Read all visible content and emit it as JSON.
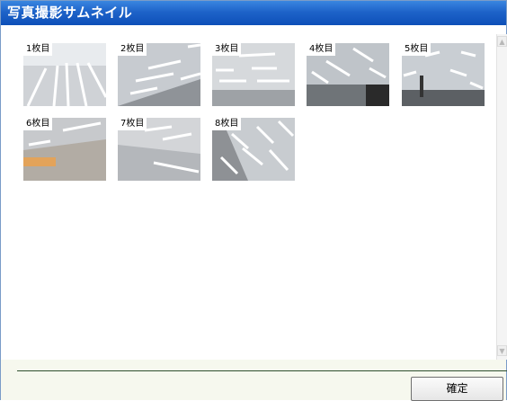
{
  "window": {
    "title": "写真撮影サムネイル"
  },
  "thumbnails": [
    {
      "label": "1枚目"
    },
    {
      "label": "2枚目"
    },
    {
      "label": "3枚目"
    },
    {
      "label": "4枚目"
    },
    {
      "label": "5枚目"
    },
    {
      "label": "6枚目"
    },
    {
      "label": "7枚目"
    },
    {
      "label": "8枚目"
    }
  ],
  "footer": {
    "confirm_label": "確定"
  },
  "scrollbar": {
    "up_glyph": "▲",
    "down_glyph": "▼"
  }
}
